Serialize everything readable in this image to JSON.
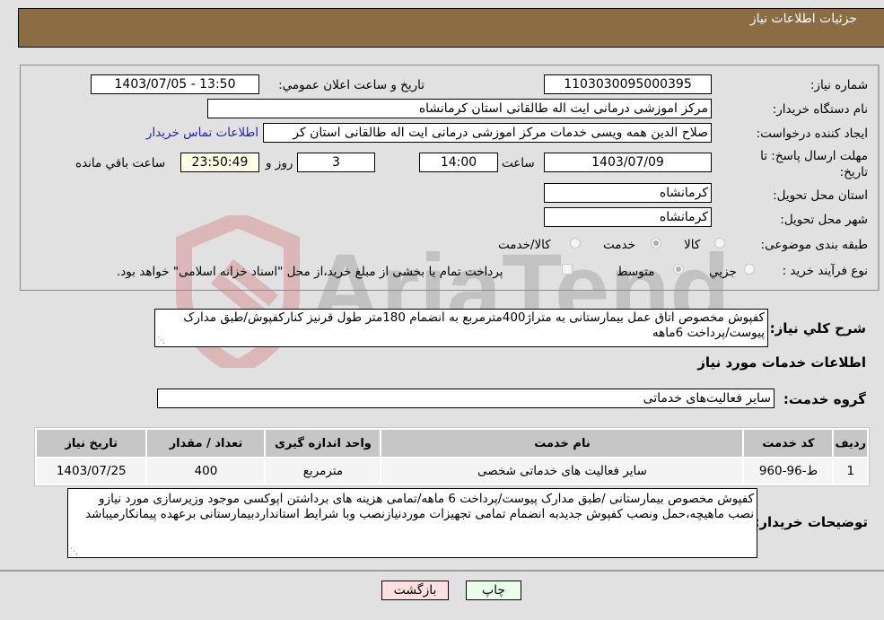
{
  "header": {
    "title": "جزئیات اطلاعات نیاز"
  },
  "form": {
    "need_number": {
      "label": "شماره نیاز:",
      "value": "1103030095000395"
    },
    "announce_datetime": {
      "label": "تاریخ و ساعت اعلان عمومي:",
      "value": "1403/07/05 - 13:50"
    },
    "buyer_org": {
      "label": "نام دستگاه خریدار:",
      "value": "مرکز اموزشی درمانی ایت اله طالقانی استان کرمانشاه"
    },
    "requester": {
      "label": "ایجاد کننده درخواست:",
      "value": "صلاح الدین همه ویسی خدمات مرکز اموزشی درمانی ایت اله طالقانی استان کر"
    },
    "buyer_contact_link": "اطلاعات تماس خریدار",
    "deadline": {
      "label": "مهلت ارسال پاسخ: تا تاریخ:",
      "date": "1403/07/09",
      "time_label": "ساعت",
      "time": "14:00",
      "days": "3",
      "days_label": "روز و",
      "remaining": "23:50:49",
      "remaining_label": "ساعت باقي مانده"
    },
    "delivery_province": {
      "label": "استان محل تحویل:",
      "value": "کرمانشاه"
    },
    "delivery_city": {
      "label": "شهر محل تحویل:",
      "value": "کرمانشاه"
    },
    "category": {
      "label": "طبقه بندی موضوعی:",
      "options": [
        {
          "label": "کالا",
          "selected": false
        },
        {
          "label": "خدمت",
          "selected": true
        },
        {
          "label": "کالا/خدمت",
          "selected": false
        }
      ]
    },
    "purchase_process": {
      "label": "نوع فرآیند خرید :",
      "options": [
        {
          "label": "جزيي",
          "selected": false
        },
        {
          "label": "متوسط",
          "selected": true
        }
      ],
      "treasury_checkbox": {
        "label": "پرداخت تمام یا بخشی از مبلغ خرید،از محل \"اسناد خزانه اسلامی\" خواهد بود.",
        "checked": false
      }
    }
  },
  "description": {
    "label": "شرح کلي نیاز:",
    "value": "کفپوش مخصوص اتاق عمل بیمارستانی به متراژ400مترمربع به انضمام 180متر طول قرنیز کنارکفپوش/طبق مدارک پیوست/پرداخت 6ماهه"
  },
  "services_section": {
    "title": "اطلاعات خدمات مورد نیاز"
  },
  "service_group": {
    "label": "گروه خدمت:",
    "value": "سایر فعالیت‌های خدماتی"
  },
  "table": {
    "headers": [
      "ردیف",
      "کد خدمت",
      "نام خدمت",
      "واحد اندازه گیری",
      "تعداد / مقدار",
      "تاریخ نیاز"
    ],
    "rows": [
      [
        "1",
        "ط-96-960",
        "سایر فعالیت های خدماتی شخصی",
        "مترمربع",
        "400",
        "1403/07/25"
      ]
    ]
  },
  "buyer_notes": {
    "label": "توضیحات خریدار:",
    "value": "کفپوش مخصوص بیمارستانی /طبق مدارک پیوست/پرداخت 6 ماهه/تمامی هزینه های برداشتن اپوکسی موجود وزیرسازی مورد نیازو نصب ماهیچه،حمل ونصب کفپوش جدیدبه انضمام تمامی تجهیزات موردنیازنصب وبا شرایط استانداردبیمارستانی برعهده پیمانکارمیباشد"
  },
  "buttons": {
    "print": "چاپ",
    "back": "بازگشت"
  },
  "watermark": {
    "text": "AriaTender.neT"
  },
  "colors": {
    "header_bg": "#8c6d43",
    "link": "#2020c8",
    "print_bg": "#eaffea",
    "back_bg": "#ffe0e0",
    "remaining_bg": "#ffffe6"
  }
}
